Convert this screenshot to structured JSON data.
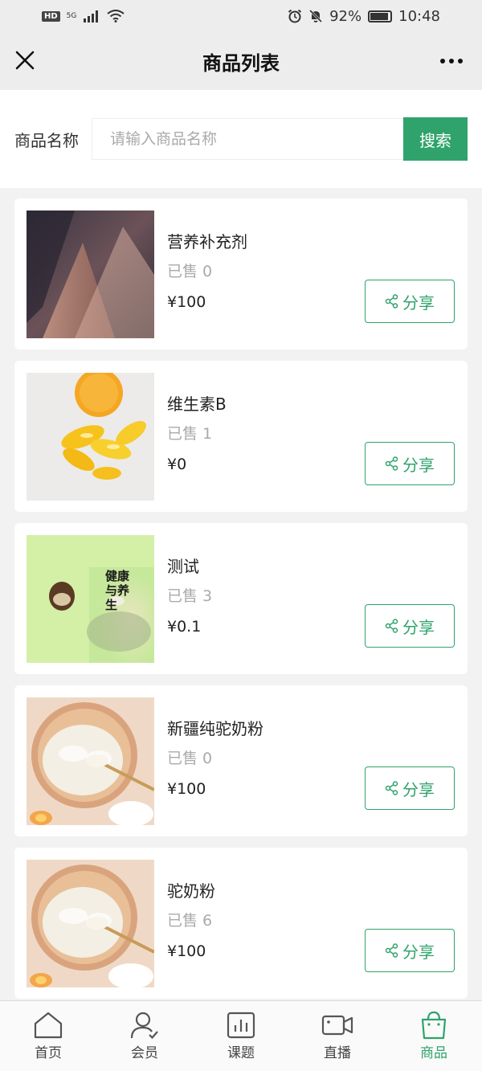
{
  "status_bar": {
    "hd": "HD",
    "network": "5G",
    "battery": "92%",
    "time": "10:48"
  },
  "nav": {
    "title": "商品列表"
  },
  "search": {
    "label": "商品名称",
    "placeholder": "请输入商品名称",
    "value": "",
    "button": "搜索"
  },
  "products": [
    {
      "name": "营养补充剂",
      "sold": "已售 0",
      "price": "¥100",
      "share": "分享"
    },
    {
      "name": "维生素B",
      "sold": "已售 1",
      "price": "¥0",
      "share": "分享"
    },
    {
      "name": "测试",
      "sold": "已售 3",
      "price": "¥0.1",
      "share": "分享"
    },
    {
      "name": "新疆纯驼奶粉",
      "sold": "已售 0",
      "price": "¥100",
      "share": "分享"
    },
    {
      "name": "驼奶粉",
      "sold": "已售 6",
      "price": "¥100",
      "share": "分享"
    }
  ],
  "product_images": {
    "p2_text": "健康与养生"
  },
  "tabs": [
    {
      "label": "首页",
      "icon": "home-icon"
    },
    {
      "label": "会员",
      "icon": "member-icon"
    },
    {
      "label": "课题",
      "icon": "chart-icon"
    },
    {
      "label": "直播",
      "icon": "video-icon"
    },
    {
      "label": "商品",
      "icon": "bag-icon",
      "active": true
    }
  ],
  "colors": {
    "accent": "#2fa36b",
    "header_bg": "#ededed",
    "page_bg": "#f2f2f2"
  }
}
